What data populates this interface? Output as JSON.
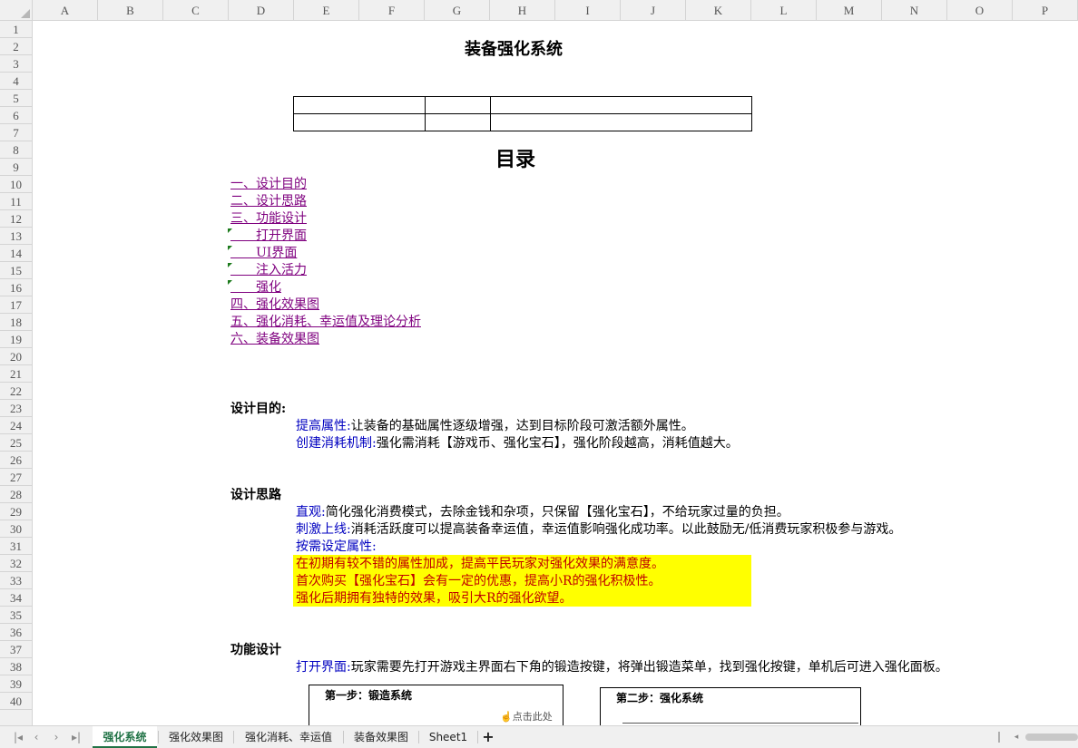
{
  "columns": [
    "A",
    "B",
    "C",
    "D",
    "E",
    "F",
    "G",
    "H",
    "I",
    "J",
    "K",
    "L",
    "M",
    "N",
    "O",
    "P"
  ],
  "rows": [
    "1",
    "2",
    "3",
    "4",
    "5",
    "6",
    "7",
    "8",
    "9",
    "10",
    "11",
    "12",
    "13",
    "14",
    "15",
    "16",
    "17",
    "18",
    "19",
    "20",
    "21",
    "22",
    "23",
    "24",
    "25",
    "26",
    "27",
    "28",
    "29",
    "30",
    "31",
    "32",
    "33",
    "34",
    "35",
    "36",
    "37",
    "38",
    "39",
    "40"
  ],
  "doc": {
    "title": "装备强化系统",
    "toc_title": "目录",
    "toc": [
      "一、设计目的",
      "二、设计思路",
      "三、功能设计",
      "　　打开界面",
      "　　UI界面",
      "　　注入活力",
      "　　强化",
      "四、强化效果图",
      "五、强化消耗、幸运值及理论分析",
      "六、装备效果图"
    ],
    "purpose": {
      "heading": "设计目的:",
      "l1_label": "提高属性:",
      "l1_text": "让装备的基础属性逐级增强，达到目标阶段可激活额外属性。",
      "l2_label": "创建消耗机制:",
      "l2_text": "强化需消耗【游戏币、强化宝石】，强化阶段越高，消耗值越大。"
    },
    "idea": {
      "heading": "设计思路",
      "l1_label": "直观:",
      "l1_text": "简化强化消费模式，去除金钱和杂项，只保留【强化宝石】，不给玩家过量的负担。",
      "l2_label": "刺激上线:",
      "l2_text": "消耗活跃度可以提高装备幸运值，幸运值影响强化成功率。以此鼓励无/低消费玩家积极参与游戏。",
      "l3_label": "按需设定属性:",
      "y1": "在初期有较不错的属性加成，提高平民玩家对强化效果的满意度。",
      "y2": "首次购买【强化宝石】会有一定的优惠，提高小R的强化积极性。",
      "y3": "强化后期拥有独特的效果，吸引大R的强化欲望。"
    },
    "func": {
      "heading": "功能设计",
      "l1_label": "打开界面:",
      "l1_text": "玩家需要先打开游戏主界面右下角的锻造按键，将弹出锻造菜单，找到强化按键，单机后可进入强化面板。",
      "img1_title": "第一步：锻造系统",
      "img1_hint": "点击此处",
      "img2_title": "第二步：强化系统"
    }
  },
  "tabs": [
    "强化系统",
    "强化效果图",
    "强化消耗、幸运值",
    "装备效果图",
    "Sheet1"
  ],
  "add_tab": "+",
  "colors": {
    "accent": "#217346",
    "link": "#7f007f",
    "label_blue": "#0000c0",
    "highlight": "#ffff00"
  }
}
